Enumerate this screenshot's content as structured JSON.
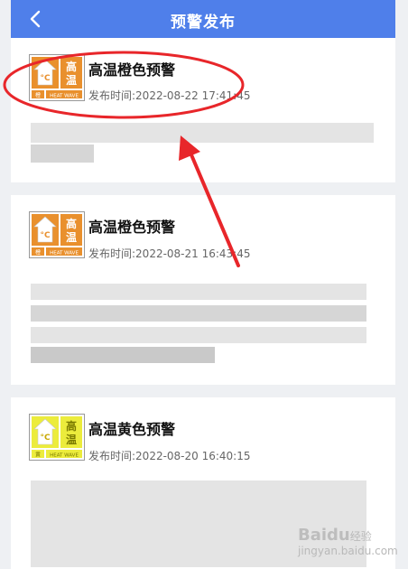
{
  "header": {
    "title": "预警发布",
    "back_icon": "chevron-left-icon"
  },
  "warnings": [
    {
      "title": "高温橙色预警",
      "time_label": "发布时间:2022-08-22 17:41:45",
      "icon": "high-temp-orange-icon",
      "icon_chars": "高温",
      "icon_footer": "HEAT WAVE",
      "icon_level_char": "橙",
      "color": "#e9902d"
    },
    {
      "title": "高温橙色预警",
      "time_label": "发布时间:2022-08-21 16:43:45",
      "icon": "high-temp-orange-icon",
      "icon_chars": "高温",
      "icon_footer": "HEAT WAVE",
      "icon_level_char": "橙",
      "color": "#e9902d"
    },
    {
      "title": "高温黄色预警",
      "time_label": "发布时间:2022-08-20 16:40:15",
      "icon": "high-temp-yellow-icon",
      "icon_chars": "高温",
      "icon_footer": "HEAT WAVE",
      "icon_level_char": "黄",
      "color": "#ecec3c"
    }
  ],
  "annotation": {
    "color": "#e8262a"
  },
  "watermark": {
    "brand": "Baidu",
    "text": "经验",
    "url": "jingyan.baidu.com"
  }
}
